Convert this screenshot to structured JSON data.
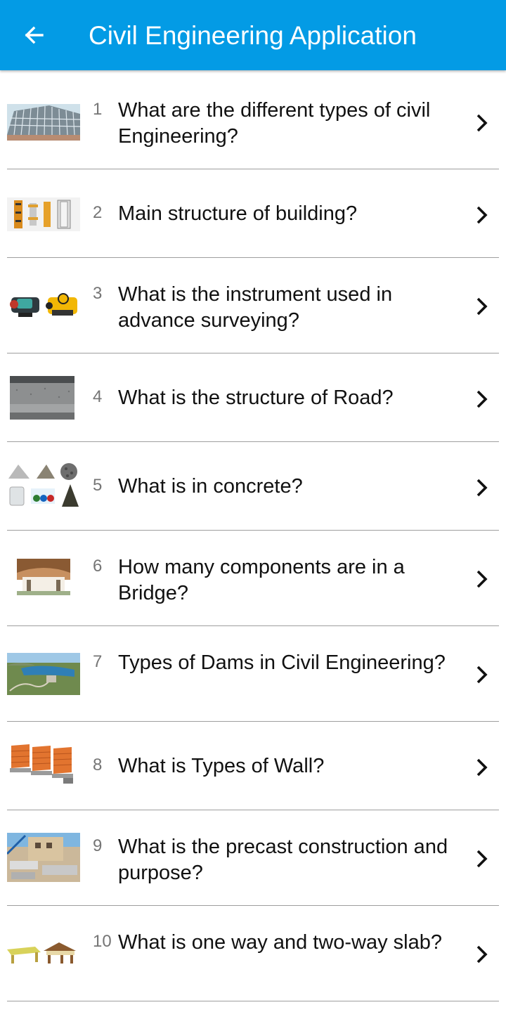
{
  "appbar": {
    "back_icon": "arrow-left-icon",
    "title": "Civil Engineering Application",
    "color": "#039be5"
  },
  "items": [
    {
      "num": "1",
      "text": "What are the different types of civil Engineering?",
      "icon": "building-facade-image"
    },
    {
      "num": "2",
      "text": "Main structure of building?",
      "icon": "column-formwork-image"
    },
    {
      "num": "3",
      "text": "What is the instrument used in advance surveying?",
      "icon": "surveying-instruments-image"
    },
    {
      "num": "4",
      "text": "What is the structure of Road?",
      "icon": "road-asphalt-image"
    },
    {
      "num": "5",
      "text": "What is in concrete?",
      "icon": "concrete-ingredients-image"
    },
    {
      "num": "6",
      "text": "How many components are in a Bridge?",
      "icon": "bridge-underside-image"
    },
    {
      "num": "7",
      "text": "Types of Dams in Civil Engineering?",
      "icon": "dam-landscape-image"
    },
    {
      "num": "8",
      "text": "What is Types of Wall?",
      "icon": "brick-walls-image"
    },
    {
      "num": "9",
      "text": "What is the precast construction and purpose?",
      "icon": "precast-construction-image"
    },
    {
      "num": "10",
      "text": "What is one way and two-way slab?",
      "icon": "slab-models-image"
    }
  ]
}
